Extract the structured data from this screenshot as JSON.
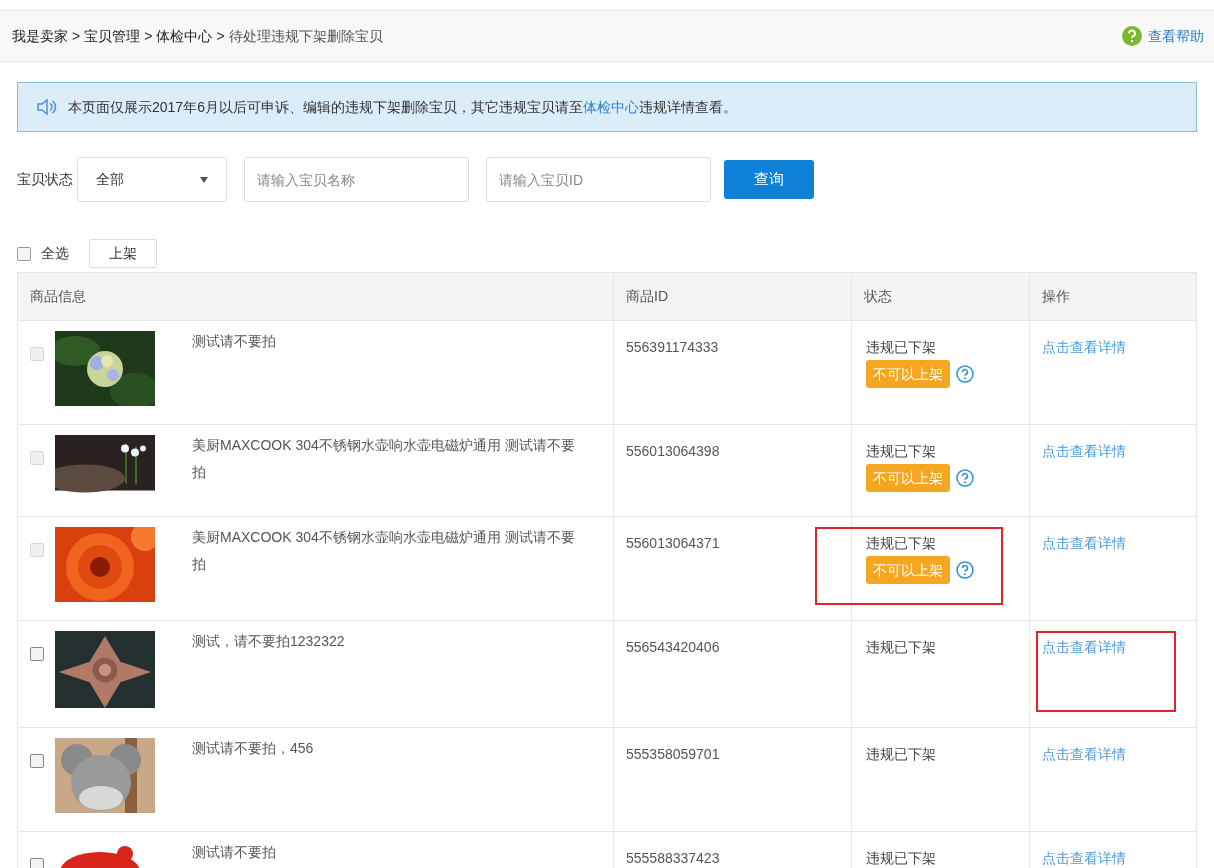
{
  "breadcrumb": [
    "我是卖家",
    "宝贝管理",
    "体检中心",
    "待处理违规下架删除宝贝"
  ],
  "breadcrumb_separator": ">",
  "help_link": "查看帮助",
  "notice": {
    "before": "本页面仅展示2017年6月以后可申诉、编辑的违规下架删除宝贝，其它违规宝贝请至",
    "link": "体检中心",
    "after": "违规详情查看。"
  },
  "filter": {
    "label": "宝贝状态",
    "select_value": "全部",
    "name_placeholder": "请输入宝贝名称",
    "id_placeholder": "请输入宝贝ID",
    "search_button": "查询"
  },
  "select_all": {
    "label": "全选",
    "checked": false
  },
  "shelve_button": "上架",
  "table": {
    "columns": [
      "商品信息",
      "商品ID",
      "状态",
      "操作"
    ],
    "rows": [
      {
        "checked": false,
        "disabled": true,
        "title": "测试请不要拍",
        "id": "556391174333",
        "status": "违规已下架",
        "tag": "不可以上架",
        "action": "点击查看详情",
        "status_marked": false,
        "action_marked": false
      },
      {
        "checked": false,
        "disabled": true,
        "title": "美厨MAXCOOK 304不锈钢水壶响水壶电磁炉通用 测试请不要拍",
        "id": "556013064398",
        "status": "违规已下架",
        "tag": "不可以上架",
        "action": "点击查看详情",
        "status_marked": false,
        "action_marked": false
      },
      {
        "checked": false,
        "disabled": true,
        "title": "美厨MAXCOOK 304不锈钢水壶响水壶电磁炉通用 测试请不要拍",
        "id": "556013064371",
        "status": "违规已下架",
        "tag": "不可以上架",
        "action": "点击查看详情",
        "status_marked": true,
        "action_marked": false
      },
      {
        "checked": false,
        "disabled": false,
        "title": "测试，请不要拍1232322",
        "id": "556543420406",
        "status": "违规已下架",
        "action": "点击查看详情",
        "status_marked": false,
        "action_marked": true
      },
      {
        "checked": false,
        "disabled": false,
        "title": "测试请不要拍，456",
        "id": "555358059701",
        "status": "违规已下架",
        "action": "点击查看详情",
        "status_marked": false,
        "action_marked": false
      },
      {
        "checked": false,
        "disabled": false,
        "title": "测试请不要拍",
        "id": "555588337423",
        "status": "违规已下架",
        "action": "点击查看详情",
        "status_marked": false,
        "action_marked": false
      }
    ]
  }
}
